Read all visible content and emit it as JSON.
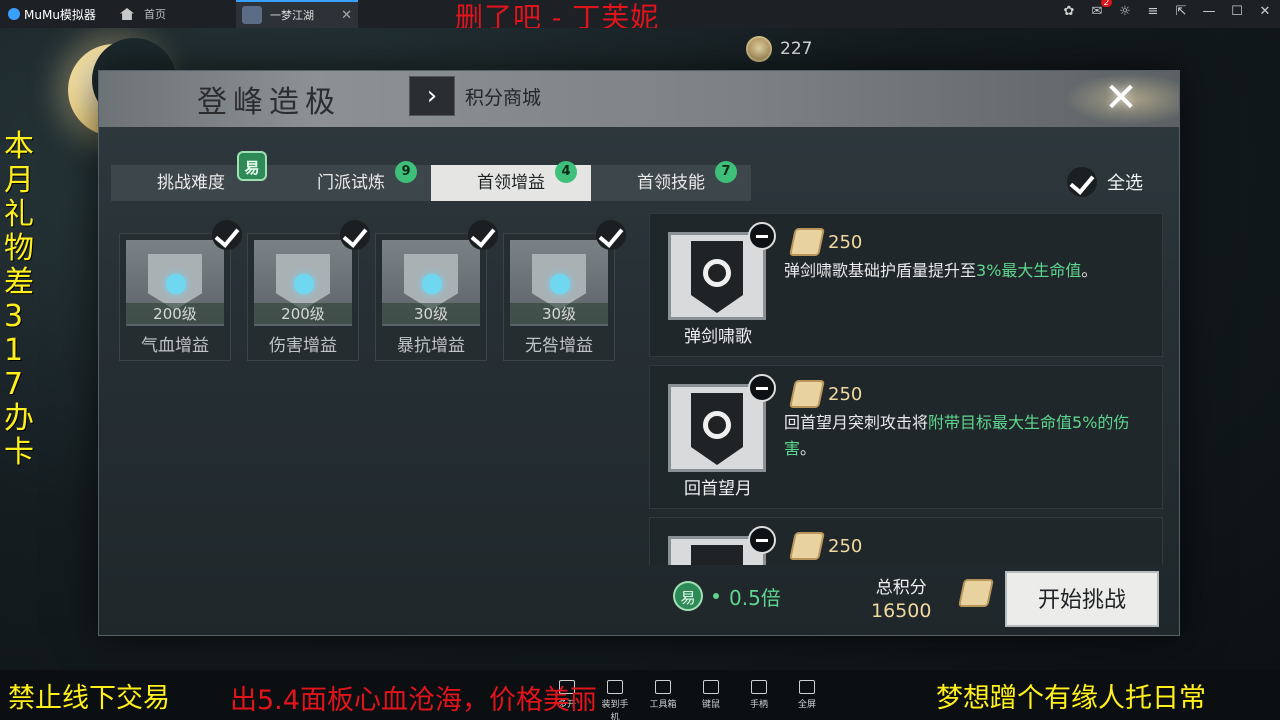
{
  "emulator": {
    "app_name": "MuMu模拟器",
    "home_label": "首页",
    "tab_title": "一梦江湖",
    "notification_count": "2"
  },
  "stream_overlay": {
    "top_title": "删了吧 - 丁芙妮",
    "left_vertical": "本月礼物差317办卡",
    "bottom_left": "禁止线下交易",
    "bottom_mid": "出5.4面板心血沧海，价格美丽",
    "bottom_right": "梦想蹭个有缘人托日常"
  },
  "hud": {
    "currency_value": "227"
  },
  "panel": {
    "title": "登峰造极",
    "shop_link": "积分商城",
    "tabs": [
      {
        "label": "挑战难度",
        "badge": "易"
      },
      {
        "label": "门派试炼",
        "badge": "9"
      },
      {
        "label": "首领增益",
        "badge": "4",
        "active": true
      },
      {
        "label": "首领技能",
        "badge": "7"
      }
    ],
    "select_all": "全选",
    "buffs": [
      {
        "level": "200级",
        "name": "气血增益"
      },
      {
        "level": "200级",
        "name": "伤害增益"
      },
      {
        "level": "30级",
        "name": "暴抗增益"
      },
      {
        "level": "30级",
        "name": "无咎增益"
      }
    ],
    "skills": [
      {
        "name": "弹剑啸歌",
        "cost": "250",
        "desc_plain": "弹剑啸歌基础护盾量提升至",
        "desc_hl": "3%最大生命值",
        "desc_tail": "。"
      },
      {
        "name": "回首望月",
        "cost": "250",
        "desc_plain": "回首望月突刺攻击将",
        "desc_hl": "附带目标最大生命值5%的伤害",
        "desc_tail": "。"
      },
      {
        "name": "",
        "cost": "250",
        "desc_plain": "",
        "desc_hl": "",
        "desc_tail": ""
      }
    ],
    "footer": {
      "difficulty_badge": "易",
      "multiplier": "0.5倍",
      "total_label": "总积分",
      "total_value": "16500",
      "start_button": "开始挑战"
    }
  },
  "toolbar": [
    "多开",
    "装到手机",
    "工具箱",
    "键鼠",
    "手柄",
    "全屏"
  ],
  "colors": {
    "highlight": "#5fd68f",
    "accent_yellow": "#ffef1a",
    "accent_red": "#e0141a"
  }
}
